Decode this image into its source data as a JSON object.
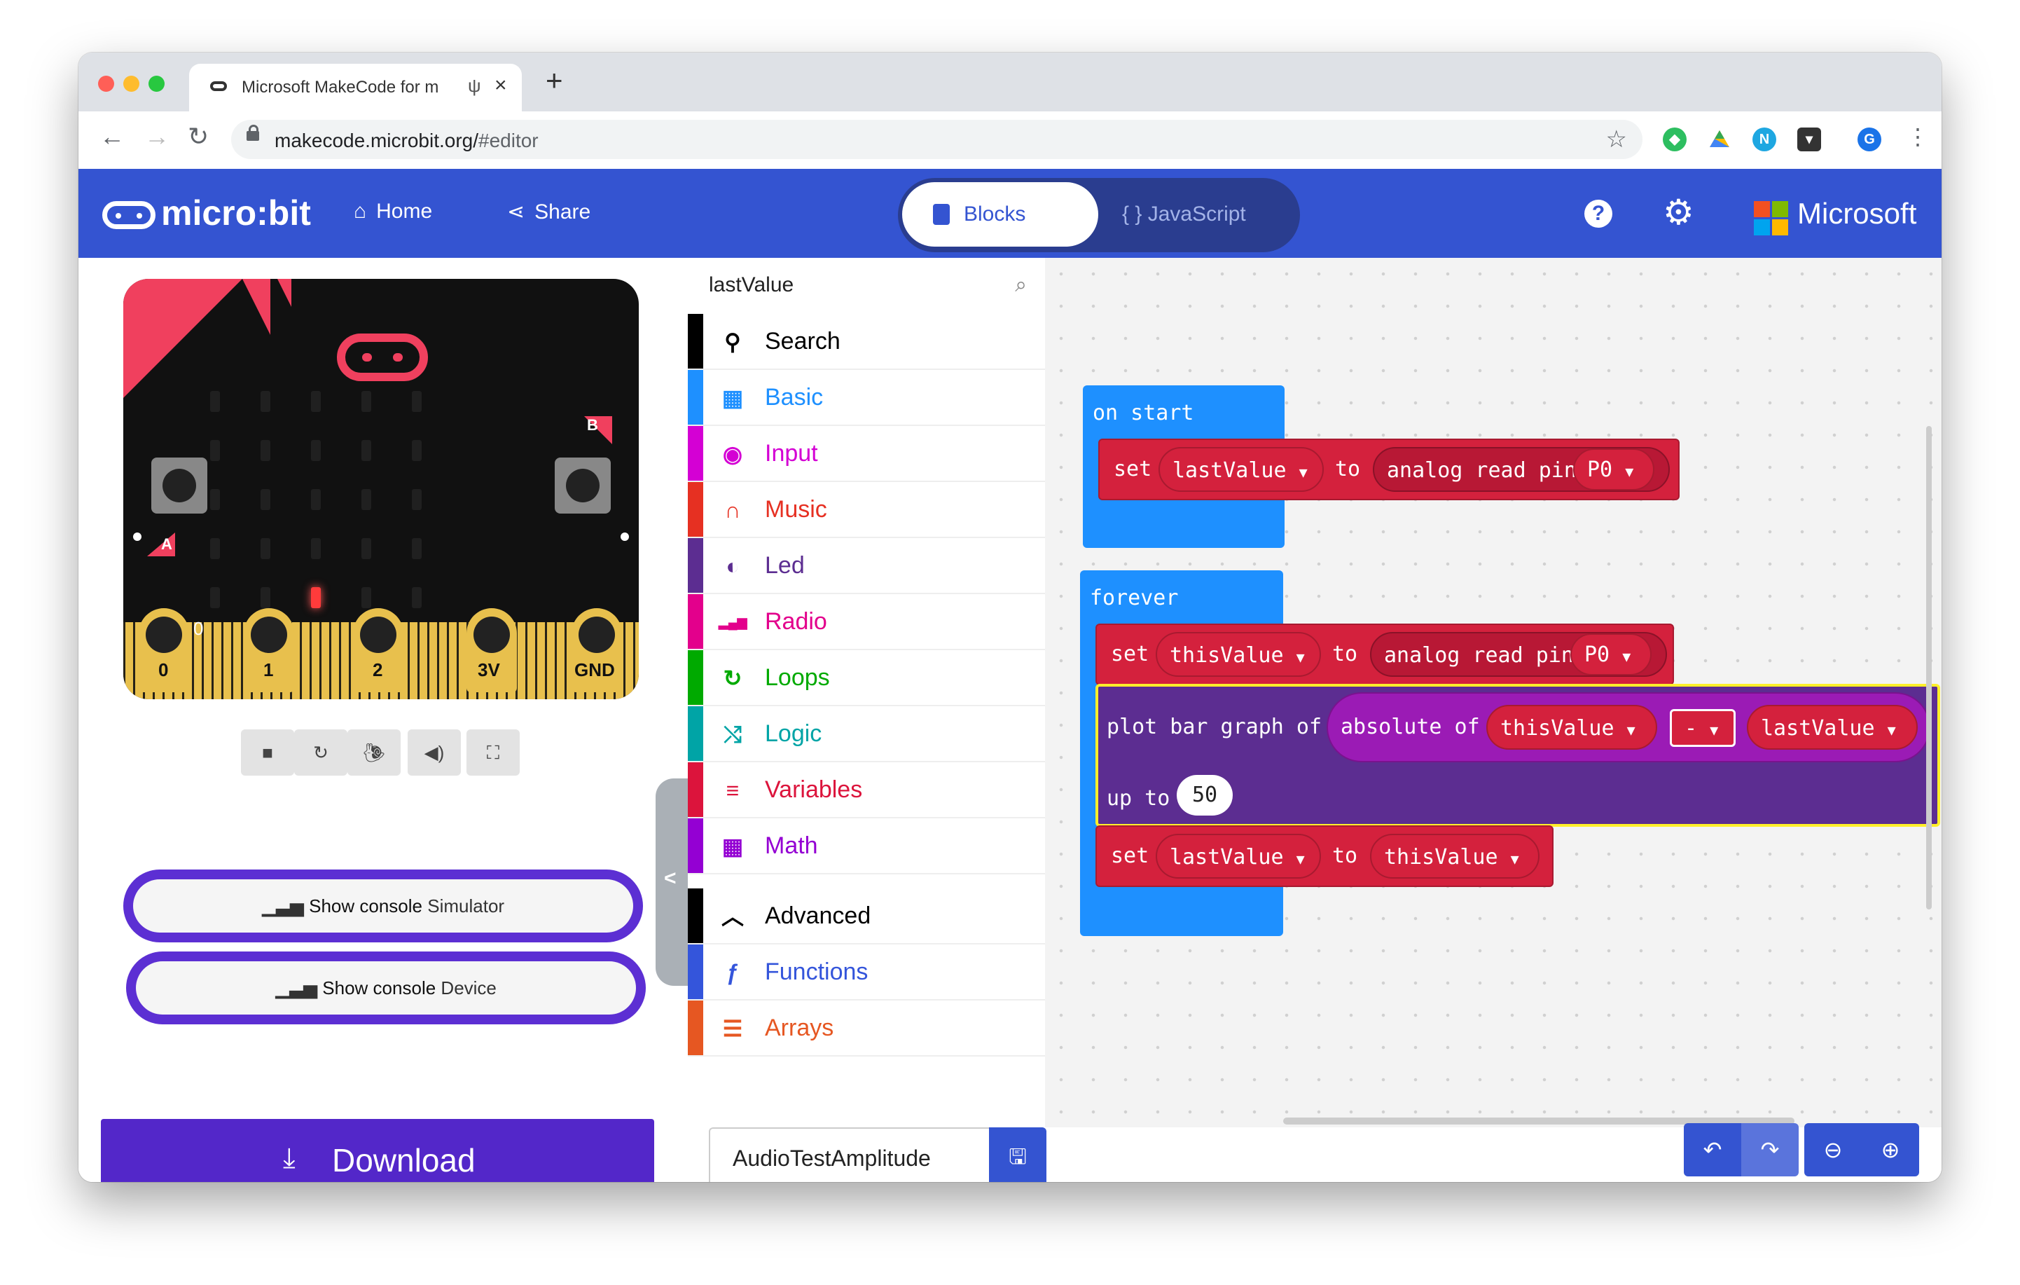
{
  "browser": {
    "tab_title": "Microsoft MakeCode for m",
    "tab_usb_icon": "usb-icon",
    "new_tab": "+",
    "url_host": "makecode.microbit.org/",
    "url_path": "#editor",
    "profile_initial": "G",
    "ext_n": "N"
  },
  "header": {
    "logo_text": "micro:bit",
    "home_label": "Home",
    "share_label": "Share",
    "blocks_label": "Blocks",
    "javascript_label": "{ } JavaScript",
    "help_label": "?",
    "microsoft_label": "Microsoft",
    "accent_color": "#3454d1"
  },
  "simulator": {
    "pin_labels": [
      "0",
      "1",
      "2",
      "3V",
      "GND"
    ],
    "pin0_reading": "0",
    "button_a": "A",
    "button_b": "B",
    "lit_led": {
      "row": 4,
      "col": 2
    },
    "console_simulator": {
      "bold": "Show console",
      "rest": "Simulator"
    },
    "console_device": {
      "bold": "Show console",
      "rest": "Device"
    },
    "toolbar_icons": [
      "stop-icon",
      "restart-icon",
      "slowmo-icon",
      "mute-icon",
      "fullscreen-icon"
    ]
  },
  "toolbox": {
    "search_value": "lastValue",
    "search_label": "Search",
    "categories": [
      {
        "label": "Basic",
        "color": "#1e90ff",
        "icon": "grid-icon"
      },
      {
        "label": "Input",
        "color": "#d400d4",
        "icon": "target-icon"
      },
      {
        "label": "Music",
        "color": "#e63022",
        "icon": "headphones-icon"
      },
      {
        "label": "Led",
        "color": "#5c2d91",
        "icon": "toggle-icon"
      },
      {
        "label": "Radio",
        "color": "#e3008c",
        "icon": "signal-icon"
      },
      {
        "label": "Loops",
        "color": "#00aa00",
        "icon": "refresh-icon"
      },
      {
        "label": "Logic",
        "color": "#00a4a6",
        "icon": "shuffle-icon"
      },
      {
        "label": "Variables",
        "color": "#dc143c",
        "icon": "list-icon"
      },
      {
        "label": "Math",
        "color": "#9400d3",
        "icon": "calculator-icon"
      }
    ],
    "advanced_label": "Advanced",
    "advanced_categories": [
      {
        "label": "Functions",
        "color": "#3455db",
        "icon": "function-icon"
      },
      {
        "label": "Arrays",
        "color": "#e65722",
        "icon": "array-icon"
      }
    ]
  },
  "workspace": {
    "on_start": {
      "hat": "on start",
      "set": "set",
      "var": "lastValue",
      "to": "to",
      "analog": "analog read pin",
      "pin": "P0"
    },
    "forever": {
      "hat": "forever",
      "set1": {
        "set": "set",
        "var": "thisValue",
        "to": "to",
        "analog": "analog read pin",
        "pin": "P0"
      },
      "plot": {
        "label": "plot bar graph of",
        "abs": "absolute of",
        "left": "thisValue",
        "op": "-",
        "right": "lastValue",
        "upto": "up to",
        "max": "50"
      },
      "set2": {
        "set": "set",
        "var": "lastValue",
        "to": "to",
        "value": "thisValue"
      }
    }
  },
  "bottom": {
    "download_label": "Download",
    "project_name": "AudioTestAmplitude"
  }
}
